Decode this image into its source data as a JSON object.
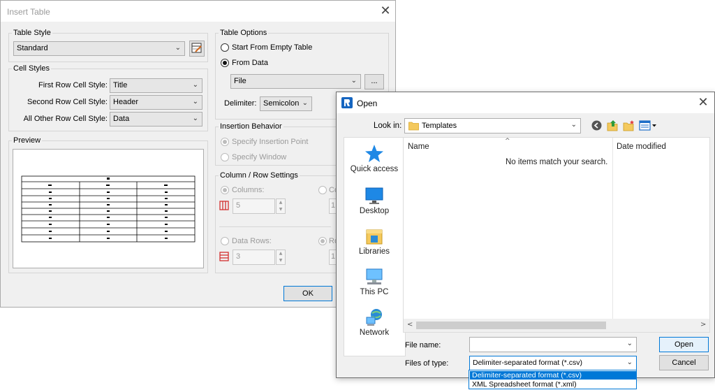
{
  "insert_table": {
    "title": "Insert Table",
    "table_style": {
      "legend": "Table Style",
      "value": "Standard"
    },
    "cell_styles": {
      "legend": "Cell Styles",
      "rows": [
        {
          "label": "First Row Cell Style:",
          "value": "Title"
        },
        {
          "label": "Second Row Cell Style:",
          "value": "Header"
        },
        {
          "label": "All Other Row Cell Style:",
          "value": "Data"
        }
      ]
    },
    "preview": {
      "legend": "Preview"
    },
    "table_options": {
      "legend": "Table Options",
      "start_empty": "Start From Empty Table",
      "from_data": "From Data",
      "data_source": "File",
      "browse_label": "...",
      "delimiter_label": "Delimiter:",
      "delimiter_value": "Semicolon"
    },
    "insertion_behavior": {
      "legend": "Insertion Behavior",
      "specify_point": "Specify Insertion Point",
      "specify_window": "Specify Window"
    },
    "col_row_settings": {
      "legend": "Column / Row Settings",
      "columns_label": "Columns:",
      "columns_value": "5",
      "col_right_label": "Co",
      "data_rows_label": "Data Rows:",
      "data_rows_value": "3",
      "row_right_label": "Ro",
      "partial_right_value": "1"
    },
    "ok_label": "OK"
  },
  "open_dialog": {
    "title": "Open",
    "look_in_label": "Look in:",
    "look_in_value": "Templates",
    "places": [
      {
        "label": "Quick access",
        "icon": "quick-access-star-icon"
      },
      {
        "label": "Desktop",
        "icon": "desktop-icon"
      },
      {
        "label": "Libraries",
        "icon": "libraries-icon"
      },
      {
        "label": "This PC",
        "icon": "this-pc-icon"
      },
      {
        "label": "Network",
        "icon": "network-icon"
      }
    ],
    "columns": {
      "name": "Name",
      "date_modified": "Date modified"
    },
    "empty_message": "No items match your search.",
    "file_name_label": "File name:",
    "file_name_value": "",
    "files_of_type_label": "Files of type:",
    "files_of_type_value": "Delimiter-separated format (*.csv)",
    "type_options": [
      "Delimiter-separated format (*.csv)",
      "XML Spreadsheet format (*.xml)"
    ],
    "open_label": "Open",
    "cancel_label": "Cancel"
  },
  "colors": {
    "accent": "#0078d7",
    "folder": "#f4c95d",
    "star": "#1e88e5"
  }
}
